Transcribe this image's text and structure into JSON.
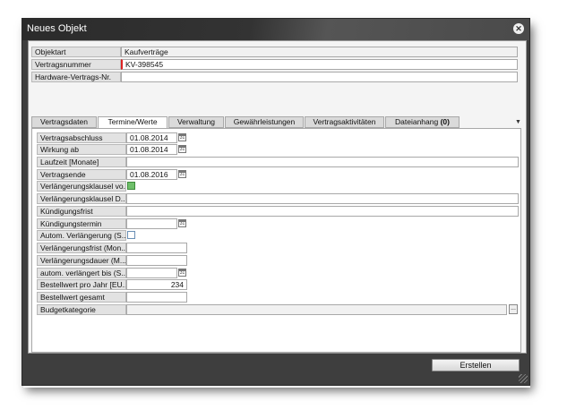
{
  "window": {
    "title": "Neues Objekt"
  },
  "header_fields": [
    {
      "label": "Objektart",
      "value": "Kaufverträge"
    },
    {
      "label": "Vertragsnummer",
      "value": "KV-398545"
    },
    {
      "label": "Hardware-Vertrags-Nr.",
      "value": ""
    }
  ],
  "tabs": [
    {
      "label": "Vertragsdaten"
    },
    {
      "label": "Termine/Werte"
    },
    {
      "label": "Verwaltung"
    },
    {
      "label": "Gewährleistungen"
    },
    {
      "label": "Vertragsaktivitäten"
    },
    {
      "label": "Dateianhang",
      "count": "(0)"
    }
  ],
  "active_tab": "Termine/Werte",
  "form": [
    {
      "label": "Vertragsabschluss",
      "value": "01.08.2014",
      "type": "date"
    },
    {
      "label": "Wirkung ab",
      "value": "01.08.2014",
      "type": "date"
    },
    {
      "label": "Laufzeit [Monate]",
      "value": "",
      "type": "text"
    },
    {
      "label": "Vertragsende",
      "value": "01.08.2016",
      "type": "date"
    },
    {
      "label": "Verlängerungsklausel vo...",
      "checked": true,
      "type": "checkbox"
    },
    {
      "label": "Verlängerungsklausel D...",
      "value": "",
      "type": "text"
    },
    {
      "label": "Kündigungsfrist",
      "value": "",
      "type": "text"
    },
    {
      "label": "Kündigungstermin",
      "value": "",
      "type": "date"
    },
    {
      "label": "Autom. Verlängerung (S...",
      "checked": false,
      "type": "checkbox"
    },
    {
      "label": "Verlängerungsfrist (Mon...",
      "value": "",
      "type": "short"
    },
    {
      "label": "Verlängerungsdauer (M...",
      "value": "",
      "type": "short"
    },
    {
      "label": "autom. verlängert bis (S...",
      "value": "",
      "type": "date"
    },
    {
      "label": "Bestellwert pro Jahr [EU...",
      "value": "234",
      "type": "number"
    },
    {
      "label": "Bestellwert gesamt",
      "value": "",
      "type": "short"
    },
    {
      "label": "Budgetkategorie",
      "value": "",
      "type": "lookup"
    }
  ],
  "calendar_icon_text": "31",
  "buttons": {
    "create": "Erstellen"
  },
  "icons": {
    "close": "close-icon",
    "calendar": "calendar-icon",
    "tab_menu": "chevron-down-icon",
    "lookup": "ellipsis-icon",
    "resize": "resize-grip-icon"
  },
  "colors": {
    "required_marker": "#d22222",
    "checkbox_on": "#6fbf6a"
  }
}
